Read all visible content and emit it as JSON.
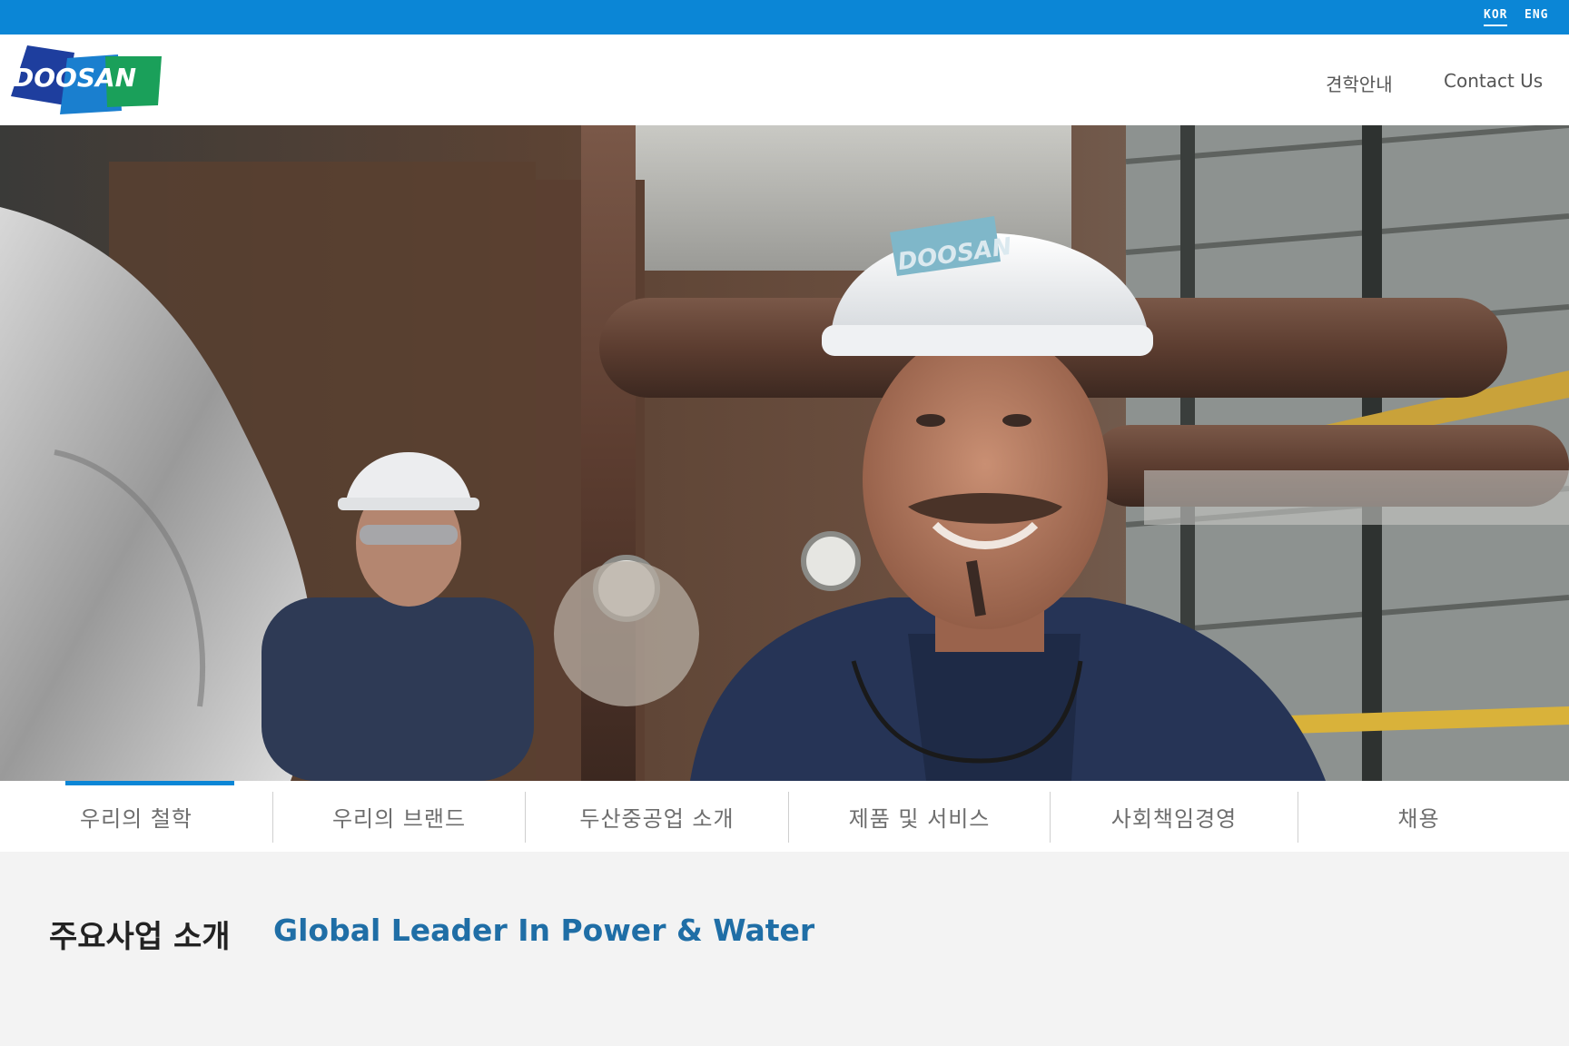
{
  "colors": {
    "top_bar": "#0b86d6",
    "brand_blue": "#1f6ea6",
    "logo_green": "#1aa05a",
    "active_tab": "#0b86d6"
  },
  "languages": [
    "KOR",
    "ENG"
  ],
  "brand": {
    "logo_text": "DOOSAN"
  },
  "header_nav": [
    "견학안내",
    "Contact Us"
  ],
  "hero": {
    "helmet_text": "DOOSAN",
    "scene": "factory-workers-photo"
  },
  "main_tabs": [
    {
      "label": "우리의 철학",
      "active": true
    },
    {
      "label": "우리의 브랜드",
      "active": false
    },
    {
      "label": "두산중공업 소개",
      "active": false
    },
    {
      "label": "제품 및 서비스",
      "active": false
    },
    {
      "label": "사회책임경영",
      "active": false
    },
    {
      "label": "채용",
      "active": false
    }
  ],
  "intro": {
    "title": "주요사업 소개",
    "tagline": "Global Leader In Power & Water"
  }
}
